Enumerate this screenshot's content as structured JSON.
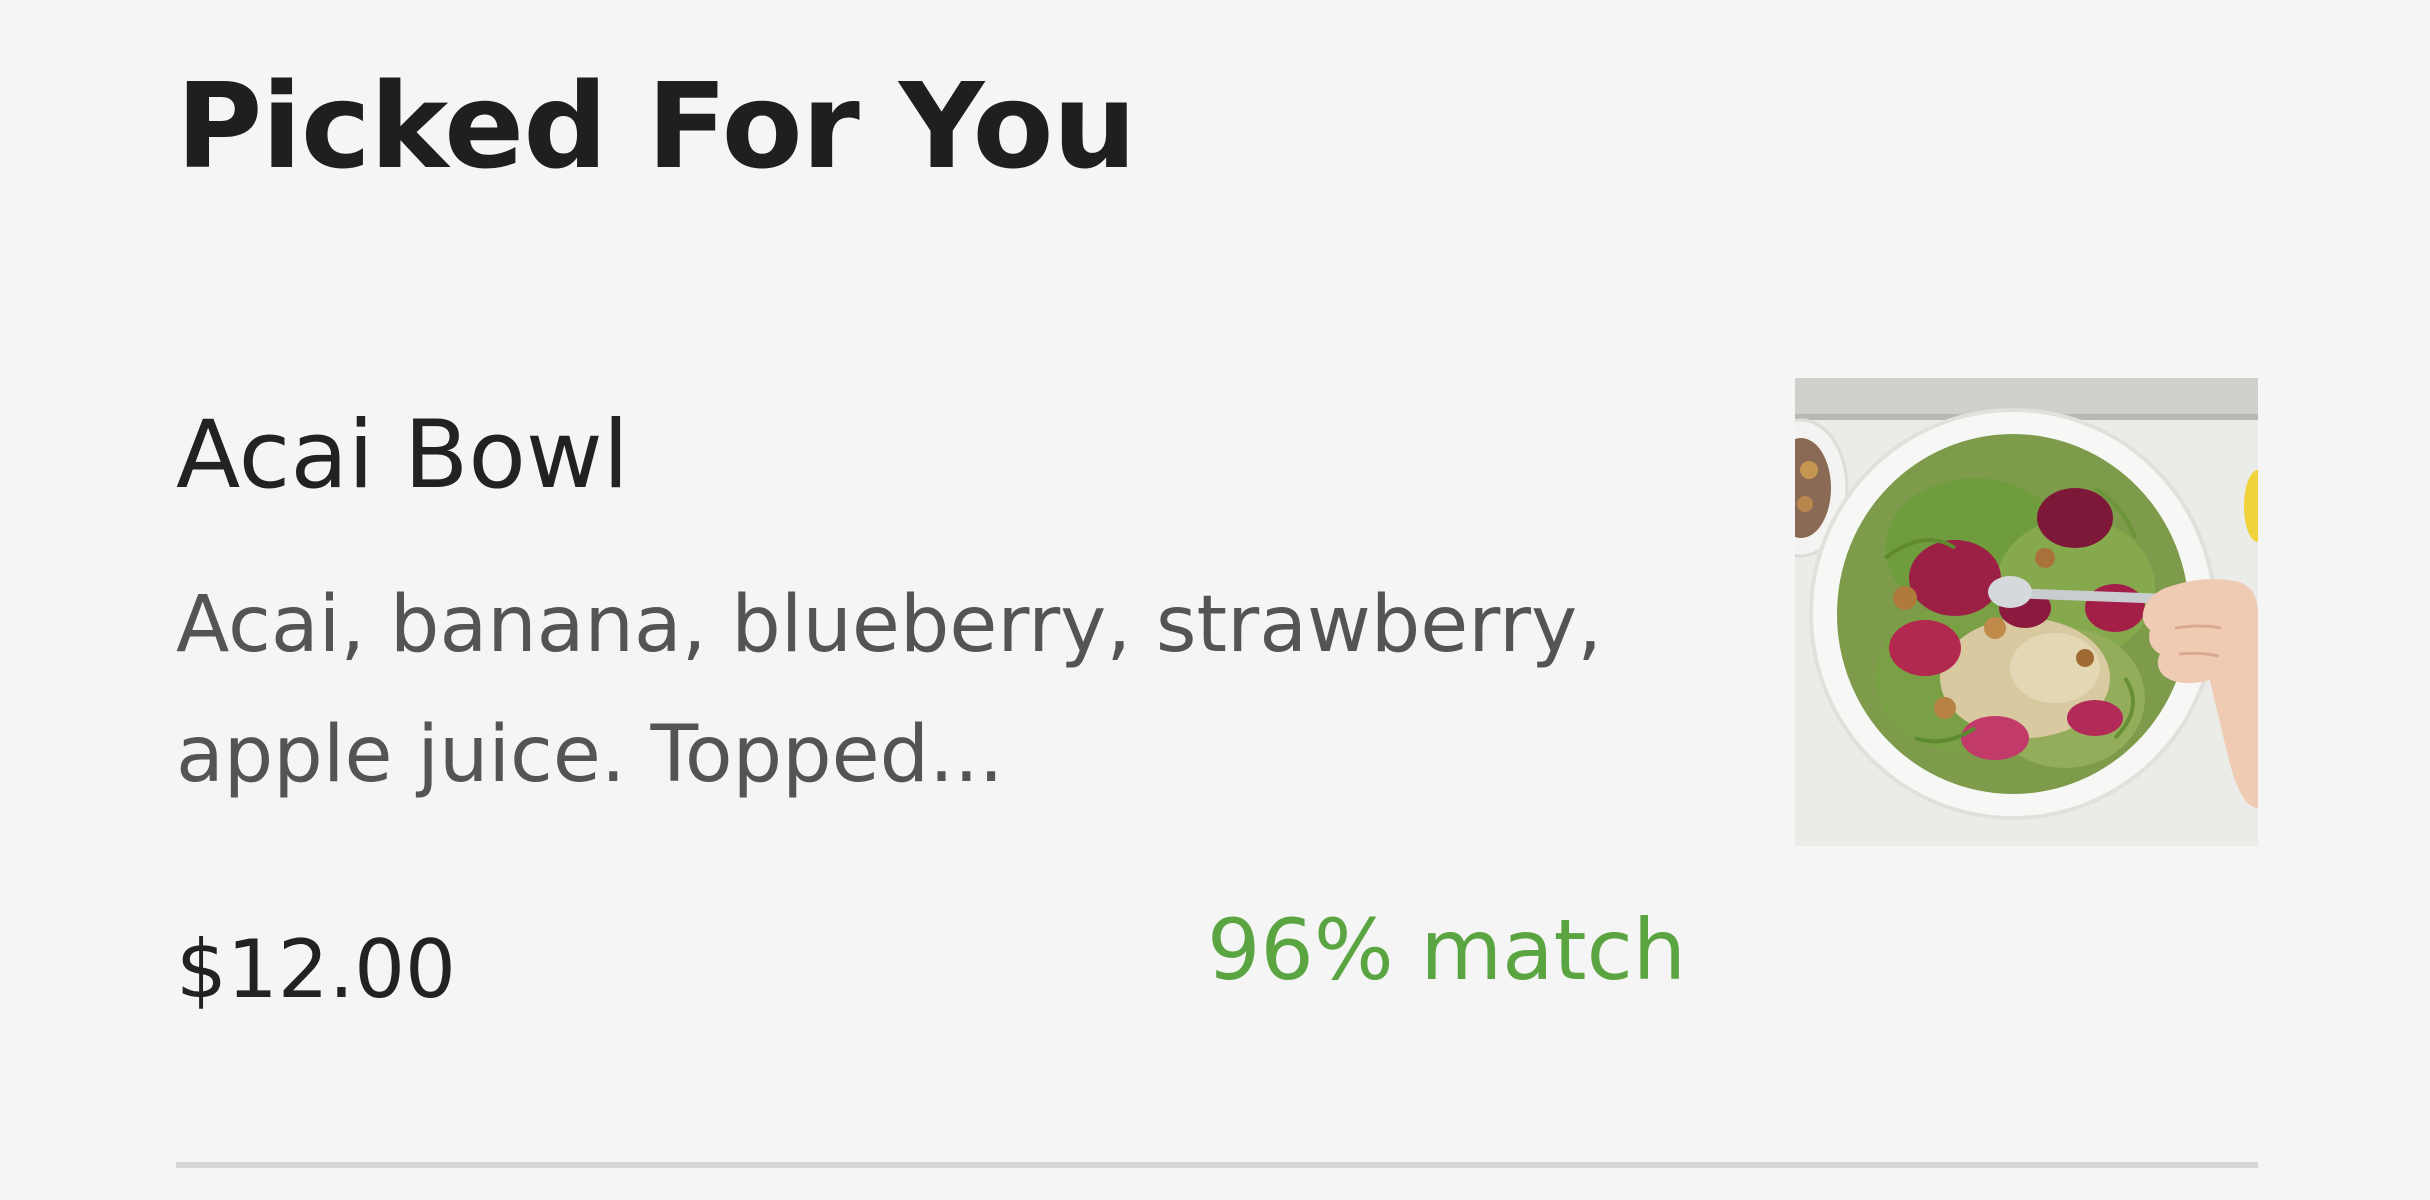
{
  "section": {
    "title": "Picked For You"
  },
  "item": {
    "name": "Acai Bowl",
    "description": "Acai, banana, blueberry, strawberry, apple juice. Topped...",
    "price": "$12.00",
    "match": "96% match",
    "image_alt": "Acai Bowl",
    "image_icon": "salad-bowl-photo"
  },
  "colors": {
    "background": "#f5f5f5",
    "title_text": "#1f1f1f",
    "description_text": "#545454",
    "match_text": "#5aa541",
    "divider": "#d6d6d6"
  }
}
